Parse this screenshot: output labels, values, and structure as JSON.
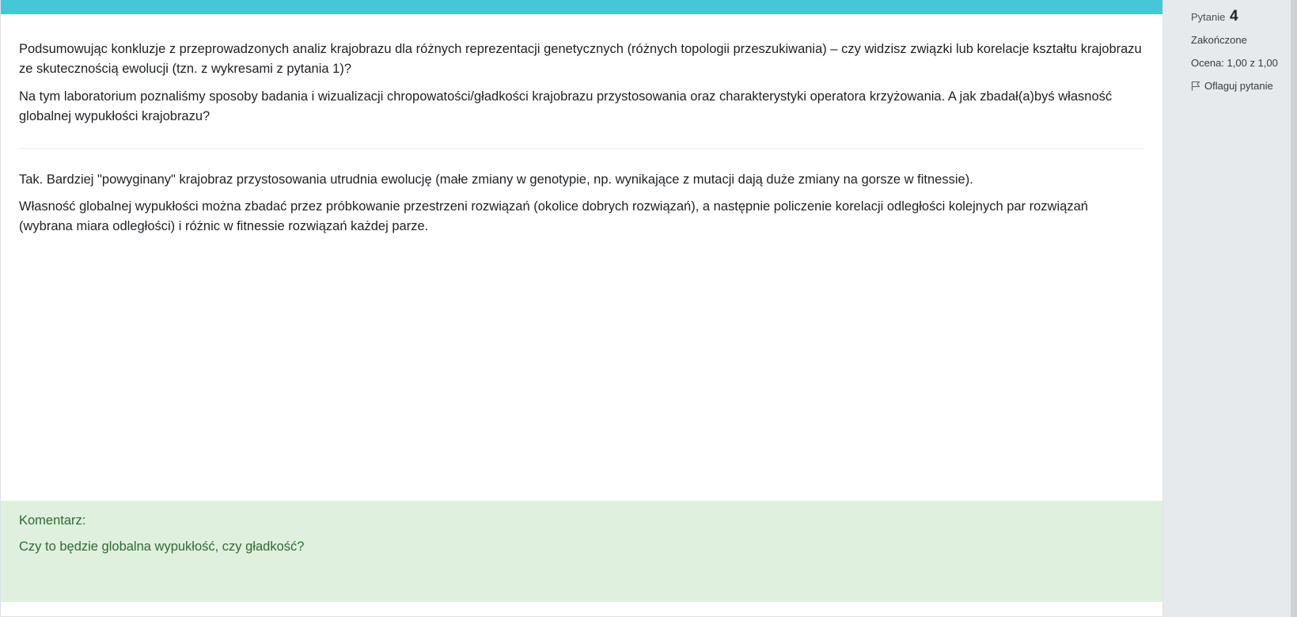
{
  "question": {
    "paragraph_1": "Podsumowując konkluzje z przeprowadzonych analiz krajobrazu dla różnych reprezentacji genetycznych (różnych topologii przeszukiwania) – czy widzisz związki lub korelacje kształtu krajobrazu ze skutecznością ewolucji (tzn. z wykresami z pytania 1)?",
    "paragraph_2": "Na tym laboratorium poznaliśmy sposoby badania i wizualizacji chropowatości/gładkości krajobrazu przystosowania oraz charakterystyki operatora krzyżowania. A jak zbadał(a)byś własność globalnej wypukłości krajobrazu?"
  },
  "answer": {
    "paragraph_1": "Tak. Bardziej \"powyginany\" krajobraz przystosowania utrudnia ewolucję (małe zmiany w genotypie, np. wynikające z mutacji dają duże zmiany na gorsze w fitnessie).",
    "paragraph_2": "Własność globalnej wypukłości można zbadać przez próbkowanie przestrzeni rozwiązań (okolice dobrych rozwiązań), a następnie policzenie korelacji odległości kolejnych par rozwiązań (wybrana miara odległości) i różnic w fitnessie rozwiązań każdej parze."
  },
  "comment": {
    "label": "Komentarz:",
    "text": "Czy to będzie globalna wypukłość, czy gładkość?"
  },
  "info": {
    "question_label": "Pytanie",
    "question_number": "4",
    "state": "Zakończone",
    "grade": "Ocena: 1,00 z 1,00",
    "flag_label": "Oflaguj pytanie"
  },
  "colors": {
    "accent_bar": "#44c8d8",
    "comment_bg": "#dff0df",
    "comment_text": "#2e6b2e",
    "sidebar_bg": "#e7eaed"
  },
  "icons": {
    "flag": "flag-icon"
  }
}
